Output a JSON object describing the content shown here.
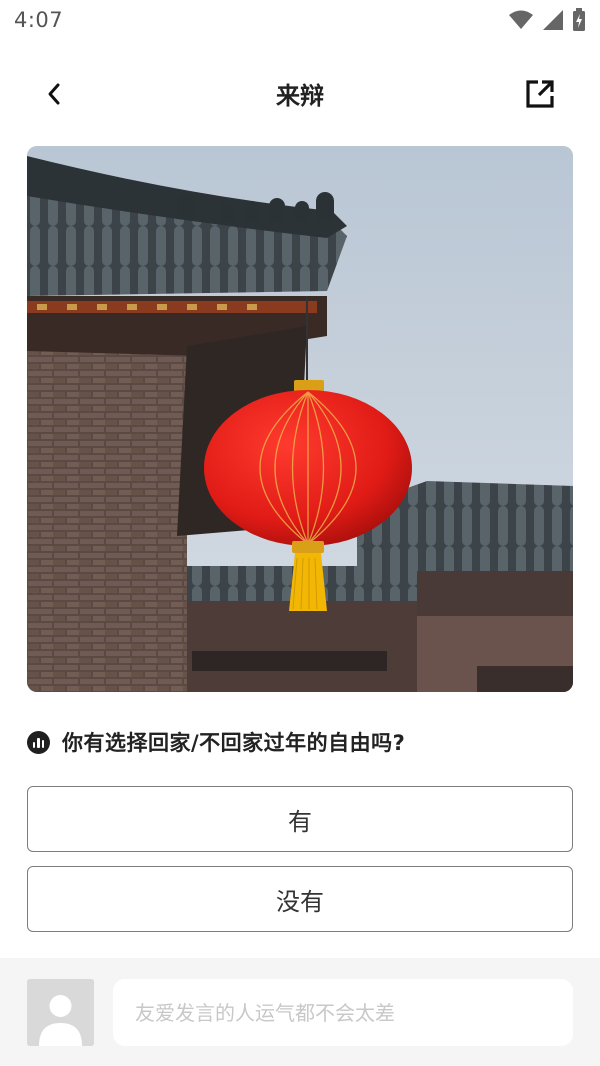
{
  "status_bar": {
    "time": "4:07"
  },
  "header": {
    "title": "来辩"
  },
  "question": {
    "text": "你有选择回家/不回家过年的自由吗?"
  },
  "options": [
    {
      "label": "有"
    },
    {
      "label": "没有"
    }
  ],
  "comment": {
    "placeholder": "友爱发言的人运气都不会太差"
  },
  "icons": {
    "back": "chevron-left-icon",
    "share": "share-external-icon",
    "poll": "poll-bars-icon",
    "avatar": "user-avatar-placeholder"
  },
  "colors": {
    "lantern_red": "#e11f1c",
    "tassel_yellow": "#f2b705",
    "sky": "#c9d3dd",
    "border": "#7d7d7d"
  }
}
